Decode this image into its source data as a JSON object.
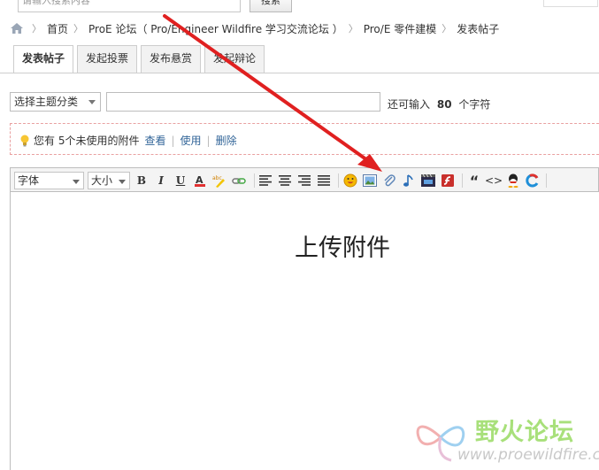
{
  "search": {
    "placeholder": "请输入搜索内容",
    "button_label": "搜索"
  },
  "breadcrumb": {
    "items": [
      "首页",
      "ProE 论坛（ Pro/Engineer Wildfire 学习交流论坛 ）",
      "Pro/E 零件建模",
      "发表帖子"
    ]
  },
  "tabs": [
    {
      "label": "发表帖子",
      "active": true
    },
    {
      "label": "发起投票",
      "active": false
    },
    {
      "label": "发布悬赏",
      "active": false
    },
    {
      "label": "发起辩论",
      "active": false
    }
  ],
  "subject": {
    "category_label": "选择主题分类",
    "hint_prefix": "还可输入",
    "hint_count": "80",
    "hint_suffix": "个字符"
  },
  "attachments_notice": {
    "text": "您有  5个未使用的附件",
    "view_link": "查看",
    "use_link": "使用",
    "delete_link": "删除"
  },
  "editor": {
    "font_label": "字体",
    "size_label": "大小",
    "bold_label": "B",
    "italic_label": "I",
    "underline_label": "U",
    "quote_label": "“",
    "code_label": "<>",
    "icons": [
      "text-color-icon",
      "highlight-icon",
      "link-icon",
      "align-left-icon",
      "align-center-icon",
      "align-right-icon",
      "align-justify-icon",
      "smiley-icon",
      "image-icon",
      "attachment-icon",
      "music-icon",
      "video-icon",
      "flash-icon",
      "quote-icon",
      "code-icon",
      "qq-icon",
      "more-icon"
    ]
  },
  "annotation": {
    "caption": "上传附件",
    "arrow_color": "#e02020"
  },
  "watermark": {
    "title": "野火论坛",
    "url": "www.proewildfire.cn"
  },
  "colors": {
    "link": "#336699",
    "notice_border": "#e9a0a0",
    "watermark_green": "#a8e07a"
  }
}
